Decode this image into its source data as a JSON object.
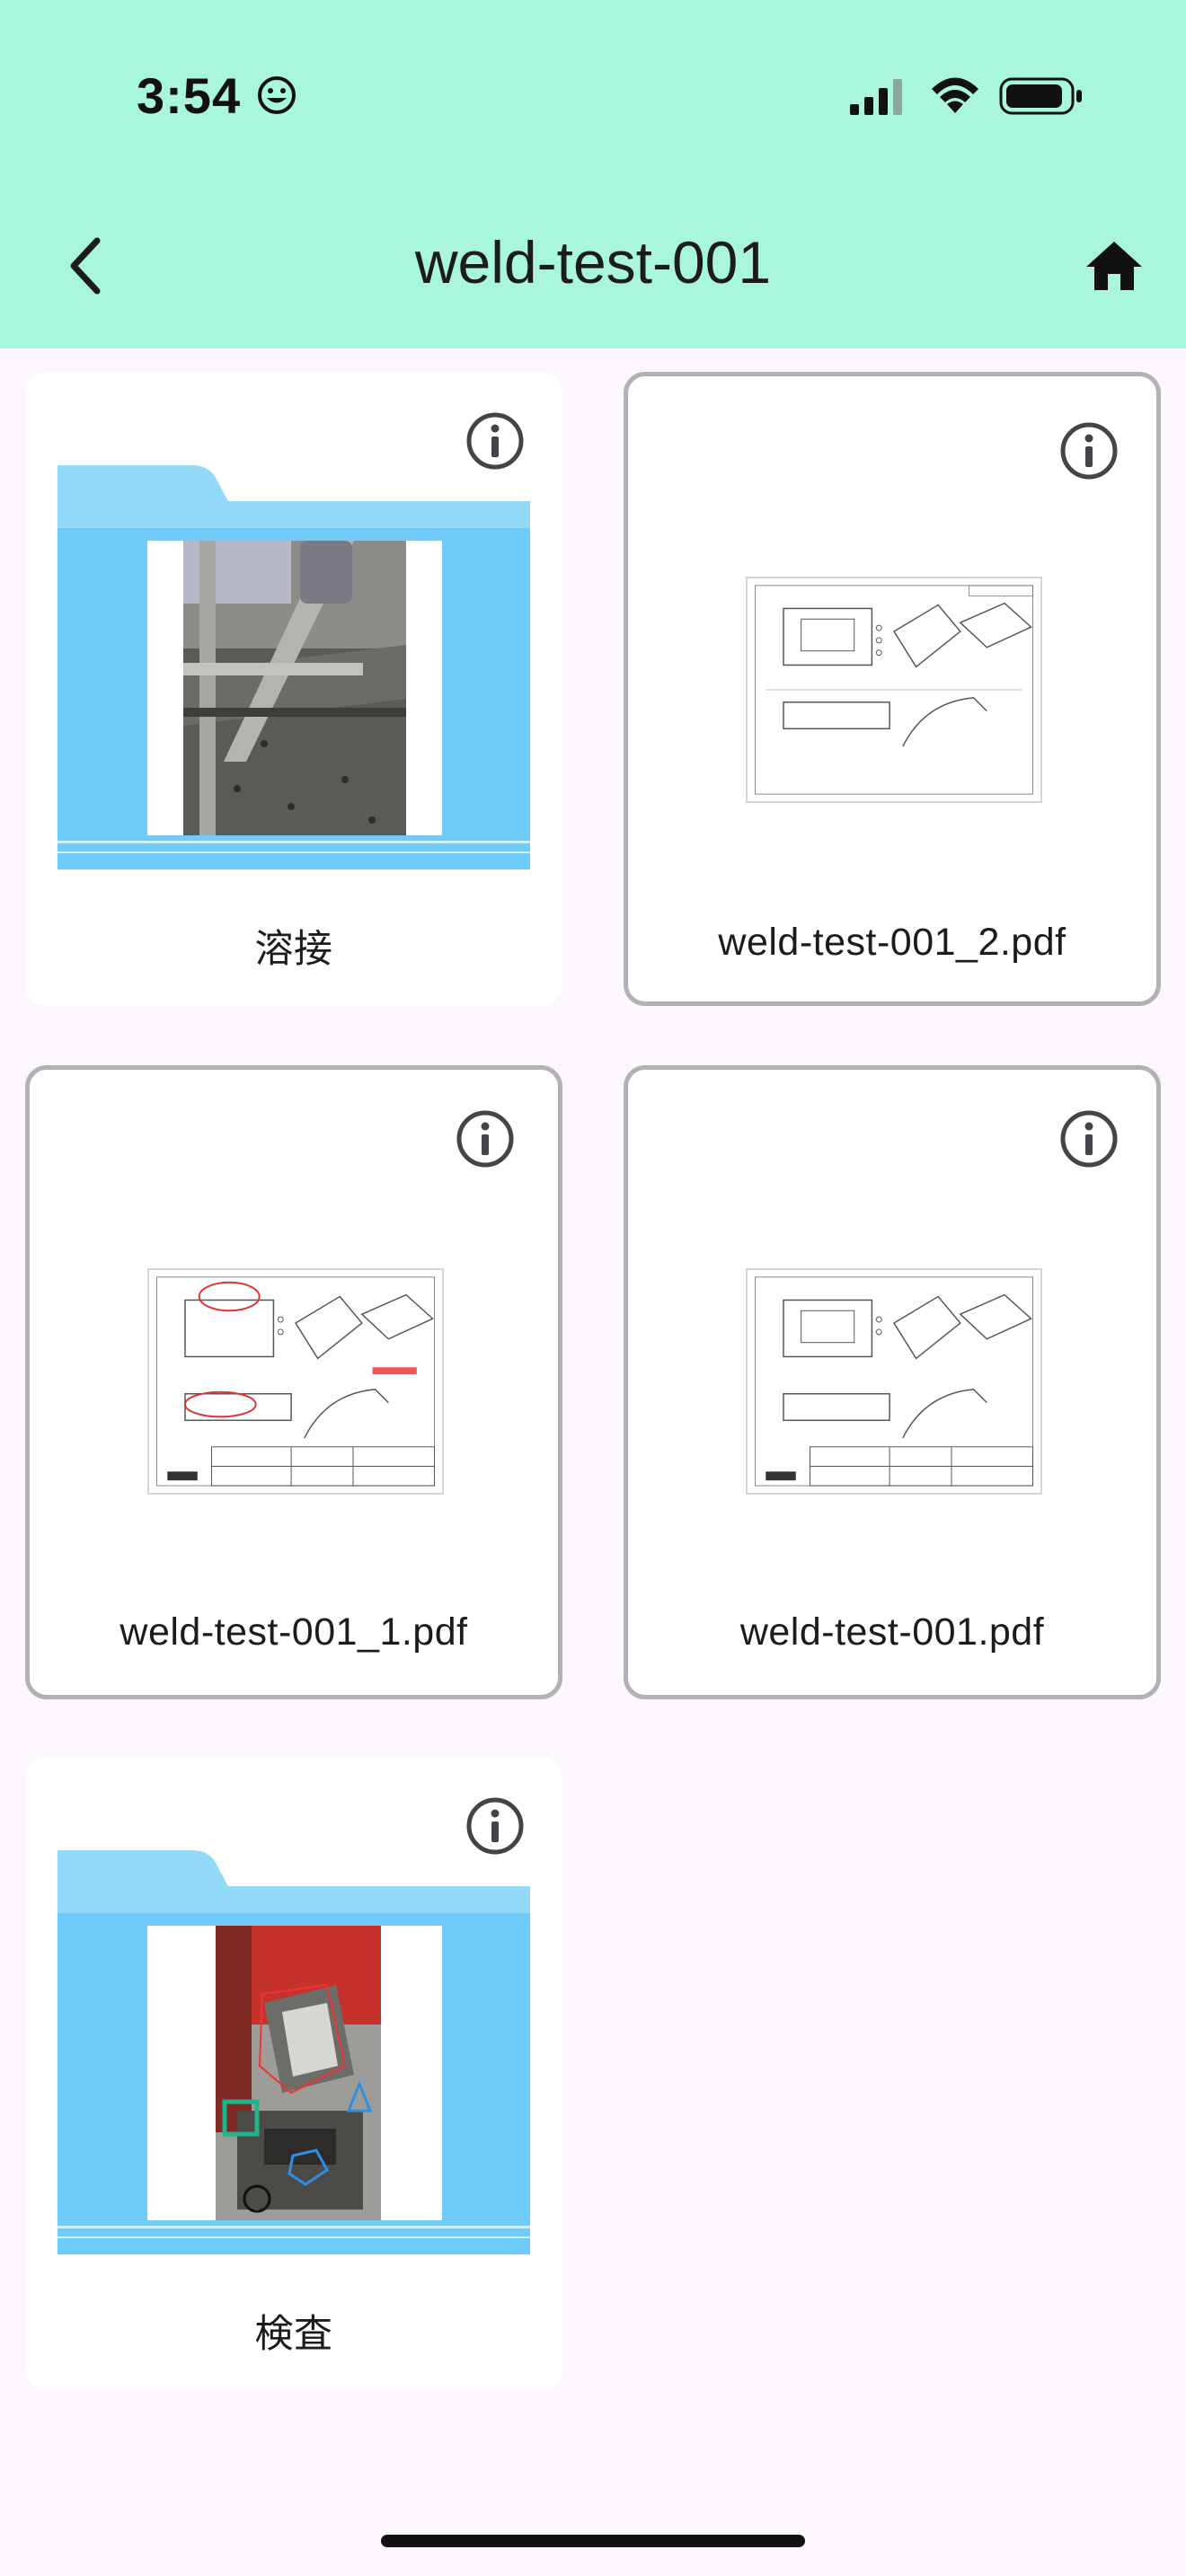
{
  "status_bar": {
    "time": "3:54"
  },
  "header": {
    "title": "weld-test-001"
  },
  "items": [
    {
      "type": "folder",
      "label": "溶接"
    },
    {
      "type": "pdf",
      "label": "weld-test-001_2.pdf"
    },
    {
      "type": "pdf",
      "label": "weld-test-001_1.pdf"
    },
    {
      "type": "pdf",
      "label": "weld-test-001.pdf"
    },
    {
      "type": "folder",
      "label": "検査"
    }
  ],
  "colors": {
    "header_bg": "#a8f6dc",
    "page_bg": "#fbf7fd",
    "folder_blue": "#6fcbf7",
    "folder_tab": "#93daf9",
    "card_border": "#b3b0b6"
  }
}
